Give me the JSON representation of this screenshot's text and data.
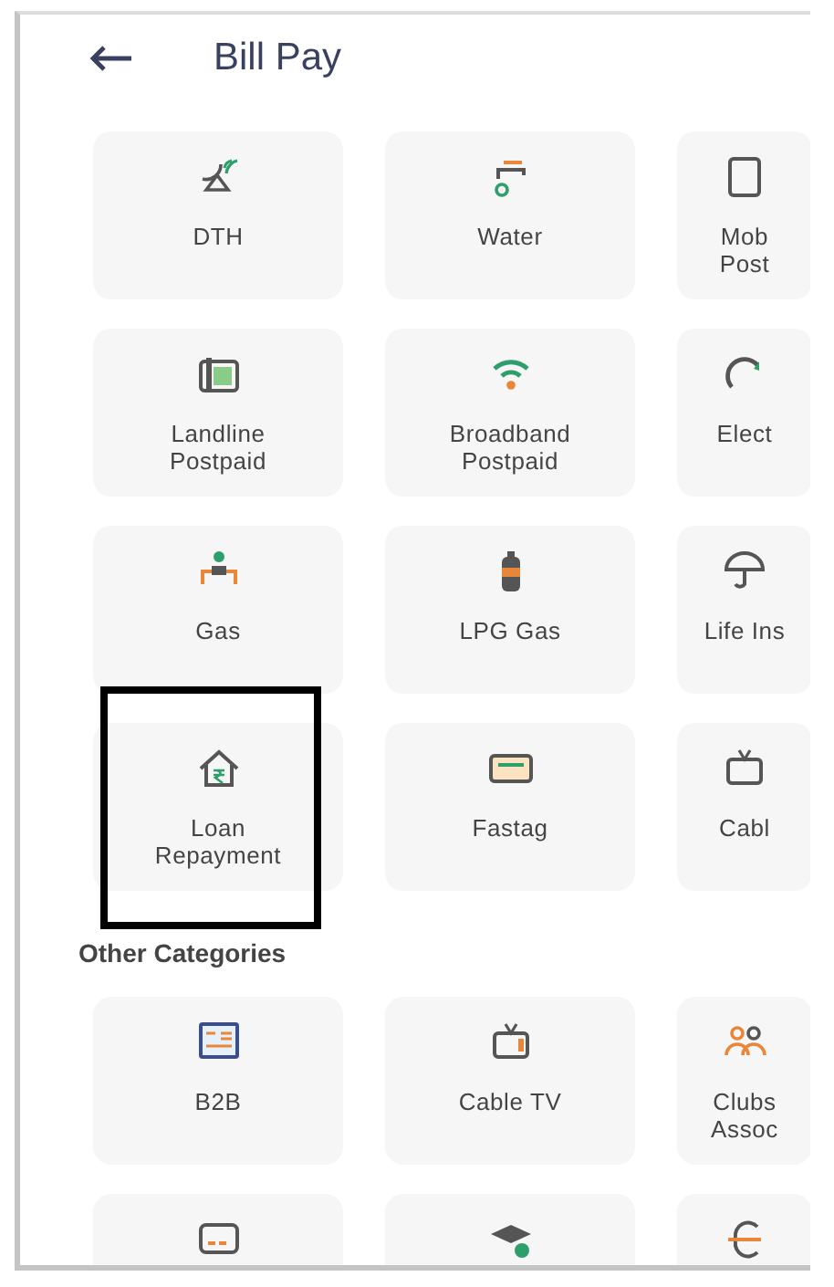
{
  "header": {
    "title": "Bill Pay"
  },
  "sections": [
    {
      "items": [
        {
          "label": "DTH",
          "highlighted": false
        },
        {
          "label": "Water",
          "highlighted": false
        },
        {
          "label": "Mob\nPost",
          "highlighted": false
        },
        {
          "label": "Landline\nPostpaid",
          "highlighted": false
        },
        {
          "label": "Broadband\nPostpaid",
          "highlighted": false
        },
        {
          "label": "Elect",
          "highlighted": false
        },
        {
          "label": "Gas",
          "highlighted": false
        },
        {
          "label": "LPG Gas",
          "highlighted": false
        },
        {
          "label": "Life Ins",
          "highlighted": false
        },
        {
          "label": "Loan\nRepayment",
          "highlighted": true
        },
        {
          "label": "Fastag",
          "highlighted": false
        },
        {
          "label": "Cabl",
          "highlighted": false
        }
      ]
    },
    {
      "heading": "Other Categories",
      "items": [
        {
          "label": "B2B",
          "highlighted": false
        },
        {
          "label": "Cable TV",
          "highlighted": false
        },
        {
          "label": "Clubs\nAssoc",
          "highlighted": false
        },
        {
          "highlighted": false
        },
        {
          "highlighted": false
        },
        {
          "highlighted": false
        }
      ]
    }
  ]
}
